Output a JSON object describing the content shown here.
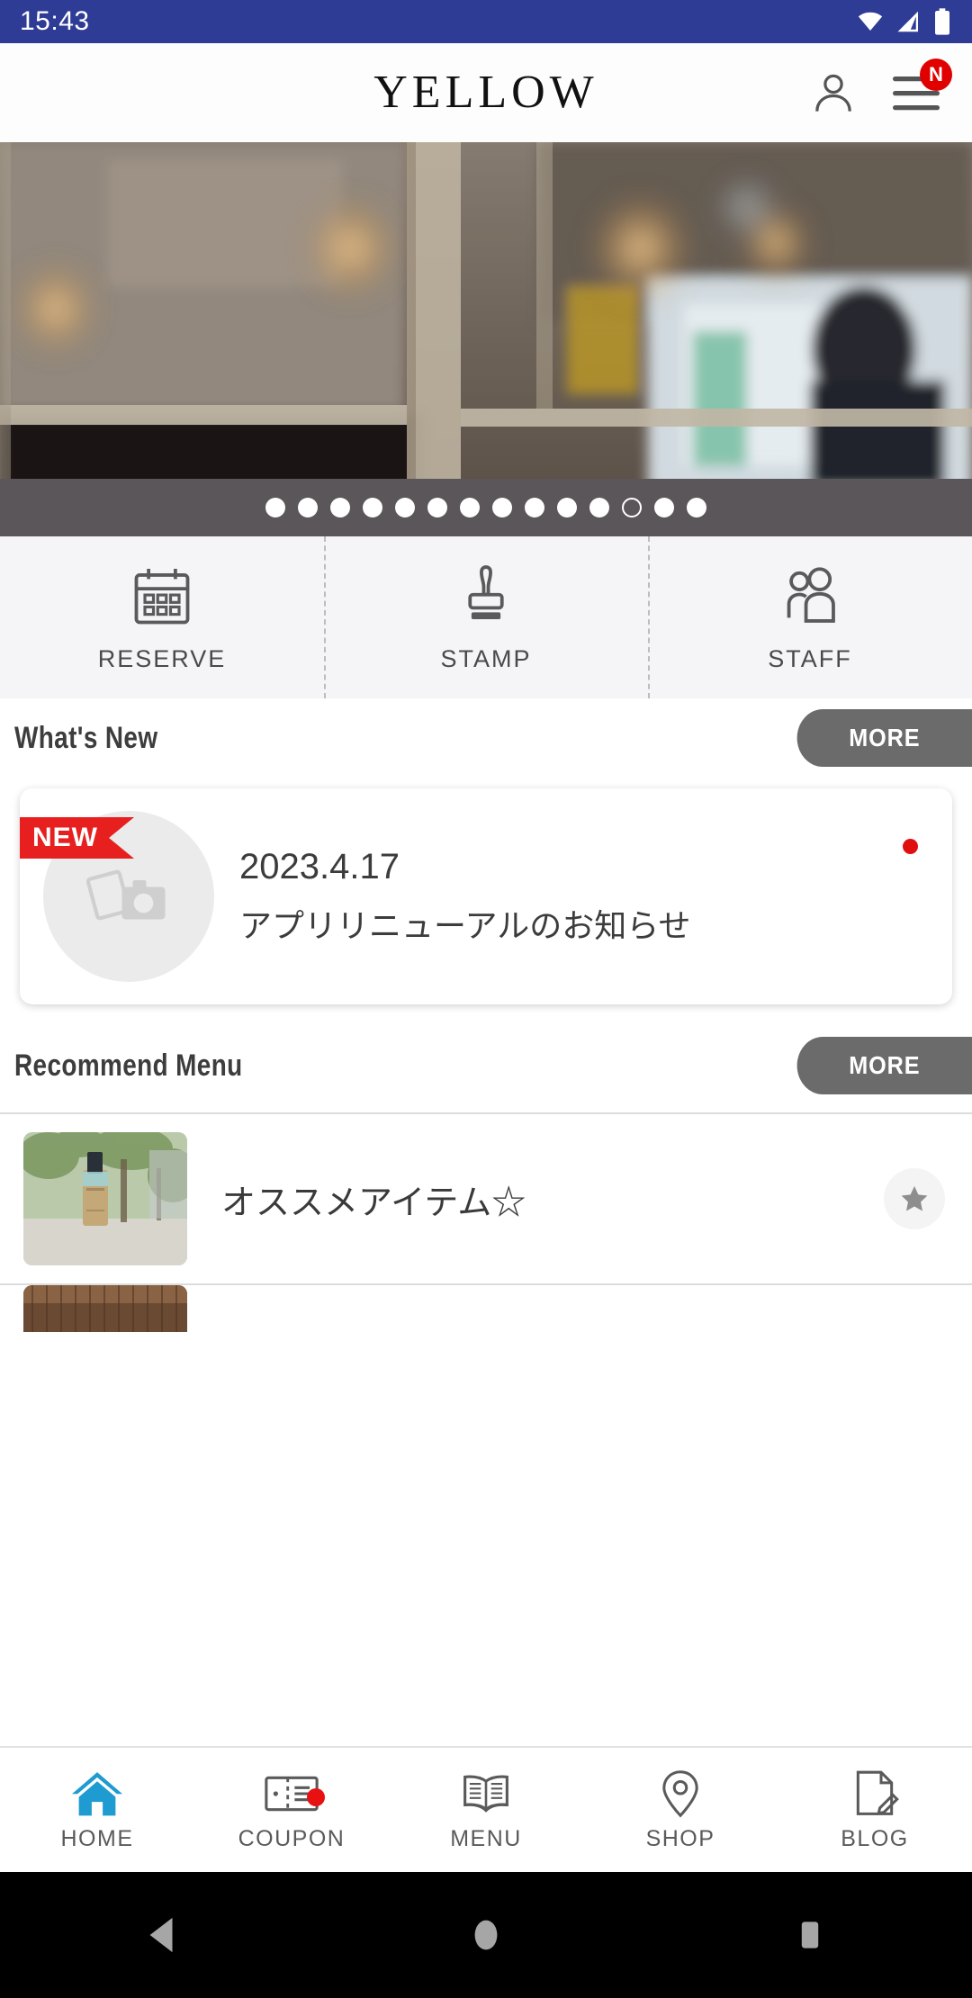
{
  "status_bar": {
    "time": "15:43",
    "icons": [
      "wifi-icon",
      "signal-icon",
      "battery-icon"
    ],
    "background": "#2f3c96"
  },
  "header": {
    "logo": "YELLOW",
    "account_icon": "person-icon",
    "menu_icon": "hamburger-menu-icon",
    "menu_badge": "N",
    "badge_color": "#e00000"
  },
  "hero": {
    "carousel_dots_total": 14,
    "carousel_active_index": 12,
    "dots_bar_color": "#5b5659"
  },
  "quick_actions": [
    {
      "label": "RESERVE",
      "icon": "calendar-icon"
    },
    {
      "label": "STAMP",
      "icon": "stamp-icon"
    },
    {
      "label": "STAFF",
      "icon": "people-icon"
    }
  ],
  "whats_new": {
    "title": "What's New",
    "more_label": "MORE",
    "items": [
      {
        "badge": "NEW",
        "date": "2023.4.17",
        "title": "アプリリニューアルのお知らせ",
        "thumb_icon": "image-placeholder-icon",
        "unread": true
      }
    ]
  },
  "recommend_menu": {
    "title": "Recommend Menu",
    "more_label": "MORE",
    "items": [
      {
        "name": "オススメアイテム☆",
        "thumb": "product-bottle-photo",
        "star_icon": "star-icon"
      },
      {
        "name": "",
        "thumb": "hair-style-photo"
      }
    ]
  },
  "bottom_nav": {
    "active": "HOME",
    "active_color": "#1e9bd1",
    "items": [
      {
        "label": "HOME",
        "icon": "home-icon",
        "active": true,
        "badge": false
      },
      {
        "label": "COUPON",
        "icon": "ticket-icon",
        "active": false,
        "badge": true
      },
      {
        "label": "MENU",
        "icon": "book-icon",
        "active": false,
        "badge": false
      },
      {
        "label": "SHOP",
        "icon": "location-pin-icon",
        "active": false,
        "badge": false
      },
      {
        "label": "BLOG",
        "icon": "document-pencil-icon",
        "active": false,
        "badge": false
      }
    ]
  },
  "android_nav": {
    "back": "back-triangle-icon",
    "home": "home-circle-icon",
    "recents": "recents-square-icon"
  }
}
